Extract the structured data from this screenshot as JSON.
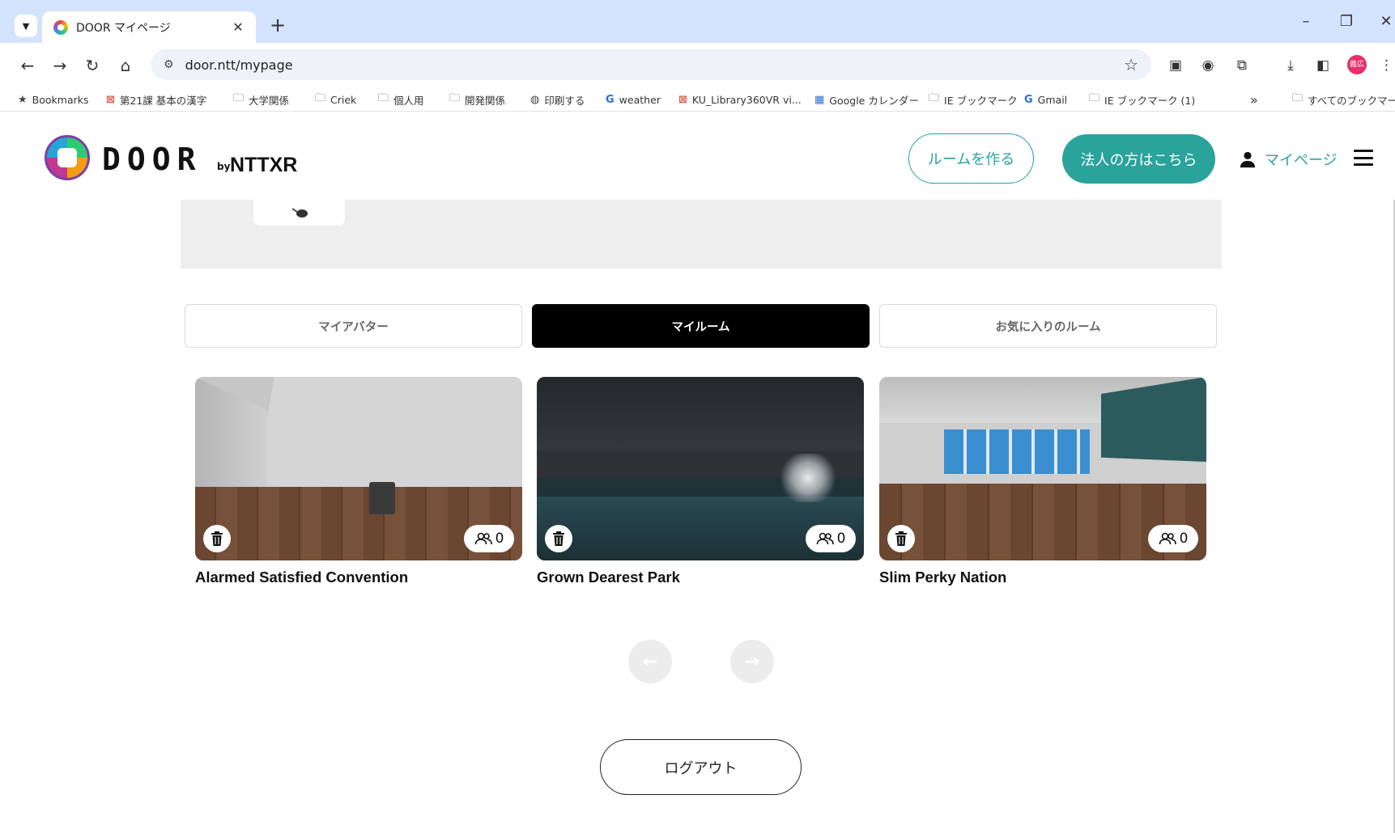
{
  "browser": {
    "tab_title": "DOOR マイページ",
    "tab_close": "✕",
    "new_tab": "+",
    "url": "door.ntt/mypage",
    "profile_initials": "義広",
    "bookmarks": [
      {
        "label": "Bookmarks",
        "icon": "star-icon"
      },
      {
        "label": "第21課 基本の漢字",
        "icon": "red-app-icon"
      },
      {
        "label": "大学関係",
        "icon": "folder-icon"
      },
      {
        "label": "Criek",
        "icon": "folder-icon"
      },
      {
        "label": "個人用",
        "icon": "folder-icon"
      },
      {
        "label": "開発関係",
        "icon": "folder-icon"
      },
      {
        "label": "印刷する",
        "icon": "globe-icon"
      },
      {
        "label": "weather",
        "icon": "google-icon"
      },
      {
        "label": "KU_Library360VR vi...",
        "icon": "red-app-icon"
      },
      {
        "label": "Google カレンダー",
        "icon": "calendar-icon"
      },
      {
        "label": "IE ブックマーク",
        "icon": "folder-icon"
      },
      {
        "label": "Gmail",
        "icon": "google-icon"
      },
      {
        "label": "IE ブックマーク (1)",
        "icon": "folder-icon"
      }
    ],
    "bookmarks_more": "»",
    "all_bookmarks": "すべてのブックマーク"
  },
  "header": {
    "logo_text": "DOOR",
    "logo_by": "by",
    "logo_brand": "NTTXR",
    "create_room_label": "ルームを作る",
    "corporate_label": "法人の方はこちら",
    "mypage_label": "マイページ"
  },
  "tabs": [
    {
      "label": "マイアバター",
      "active": false
    },
    {
      "label": "マイルーム",
      "active": true
    },
    {
      "label": "お気に入りのルーム",
      "active": false
    }
  ],
  "rooms": [
    {
      "name": "Alarmed Satisfied Convention",
      "count": "0"
    },
    {
      "name": "Grown Dearest Park",
      "count": "0"
    },
    {
      "name": "Slim Perky Nation",
      "count": "0"
    }
  ],
  "pager": {
    "prev": "←",
    "next": "→"
  },
  "logout_label": "ログアウト",
  "colors": {
    "accent": "#2aa39b",
    "active_tab": "#000000",
    "banner": "#eeeeee"
  }
}
